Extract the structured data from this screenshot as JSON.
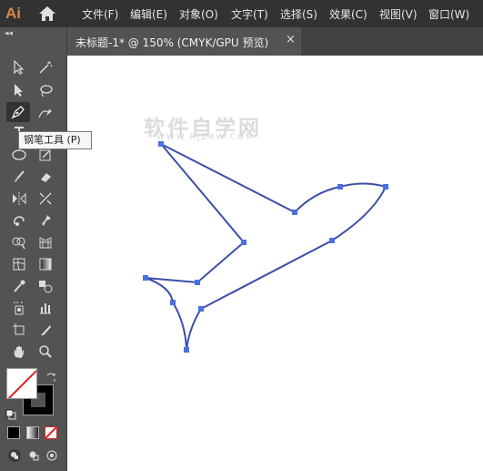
{
  "app": {
    "logo_text": "Ai"
  },
  "menu": [
    {
      "label": "文件(F)"
    },
    {
      "label": "编辑(E)"
    },
    {
      "label": "对象(O)"
    },
    {
      "label": "文字(T)"
    },
    {
      "label": "选择(S)"
    },
    {
      "label": "效果(C)"
    },
    {
      "label": "视图(V)"
    },
    {
      "label": "窗口(W)"
    }
  ],
  "document": {
    "tab_title": "未标题-1* @ 150% (CMYK/GPU 预览)",
    "close_glyph": "×"
  },
  "toolbar": {
    "collapse_glyph": "◂◂",
    "active_tool": "pen-tool",
    "tooltip": "钢笔工具 (P)"
  },
  "canvas": {
    "watermark": "软件自学网",
    "watermark_sub": "WWW.RJZXW.COM",
    "path_color": "#3b4fa8",
    "anchor_color": "#4a6fe0"
  },
  "colors": {
    "menubar": "#323232",
    "panel": "#535353",
    "accent_logo": "#d7874f"
  }
}
